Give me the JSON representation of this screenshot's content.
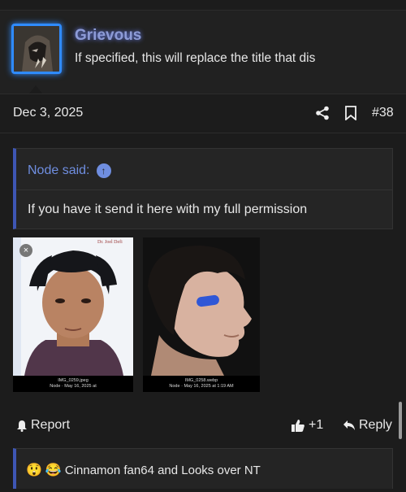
{
  "post": {
    "username": "Grievous",
    "user_title": "If specified, this will replace the title that dis",
    "date": "Dec 3, 2025",
    "post_number": "#38"
  },
  "quote": {
    "author": "Node said:",
    "body": "If you have it send it here with my full permission"
  },
  "attachments": [
    {
      "filename": "IMG_0259.jpeg",
      "meta": "Node · May 16, 2025 at",
      "logo": "Dr. Joel Defi"
    },
    {
      "filename": "IMG_0258.webp",
      "meta": "Node · May 16, 2025 at 1:19 AM"
    }
  ],
  "actions": {
    "report_label": "Report",
    "like_count": "+1",
    "reply_label": "Reply"
  },
  "reactions": {
    "emojis": [
      "😲",
      "😂"
    ],
    "text": "Cinnamon fan64 and Looks over NT"
  },
  "colors": {
    "accent": "#3e56b4",
    "username_glow": "#6e86ff",
    "avatar_border": "#2f8bff"
  }
}
